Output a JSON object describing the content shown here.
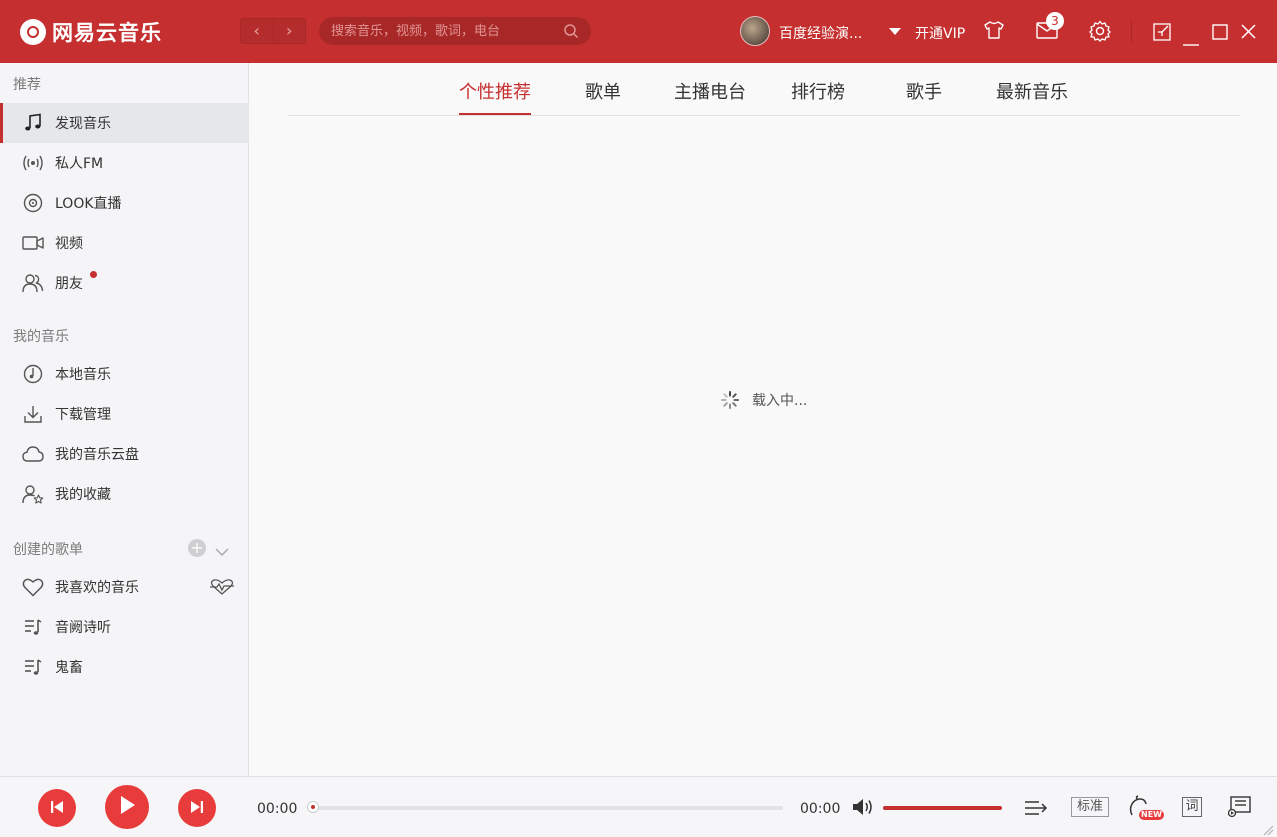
{
  "app": {
    "title": "网易云音乐"
  },
  "search": {
    "placeholder": "搜索音乐，视频，歌词，电台"
  },
  "header": {
    "username": "百度经验演...",
    "vip_label": "开通VIP",
    "message_count": "3"
  },
  "sidebar": {
    "sections": {
      "recommend": "推荐",
      "my_music": "我的音乐",
      "created_playlists": "创建的歌单"
    },
    "recommend_items": [
      {
        "label": "发现音乐",
        "icon": "music-note-icon"
      },
      {
        "label": "私人FM",
        "icon": "radio-icon"
      },
      {
        "label": "LOOK直播",
        "icon": "live-icon"
      },
      {
        "label": "视频",
        "icon": "video-icon"
      },
      {
        "label": "朋友",
        "icon": "friends-icon"
      }
    ],
    "my_music_items": [
      {
        "label": "本地音乐",
        "icon": "local-music-icon"
      },
      {
        "label": "下载管理",
        "icon": "download-icon"
      },
      {
        "label": "我的音乐云盘",
        "icon": "cloud-icon"
      },
      {
        "label": "我的收藏",
        "icon": "collection-icon"
      }
    ],
    "playlist_items": [
      {
        "label": "我喜欢的音乐",
        "icon": "heart-icon"
      },
      {
        "label": "音阙诗听",
        "icon": "playlist-icon"
      },
      {
        "label": "鬼畜",
        "icon": "playlist-icon"
      }
    ]
  },
  "tabs": [
    {
      "label": "个性推荐",
      "active": true
    },
    {
      "label": "歌单",
      "active": false
    },
    {
      "label": "主播电台",
      "active": false
    },
    {
      "label": "排行榜",
      "active": false
    },
    {
      "label": "歌手",
      "active": false
    },
    {
      "label": "最新音乐",
      "active": false
    }
  ],
  "main": {
    "loading_text": "载入中..."
  },
  "player": {
    "current_time": "00:00",
    "total_time": "00:00",
    "progress": 0,
    "volume": 1.0,
    "quality_label": "标准",
    "lyrics_label": "词",
    "new_badge": "NEW"
  },
  "colors": {
    "brand": "#c62f2f",
    "control": "#e83c3c"
  }
}
